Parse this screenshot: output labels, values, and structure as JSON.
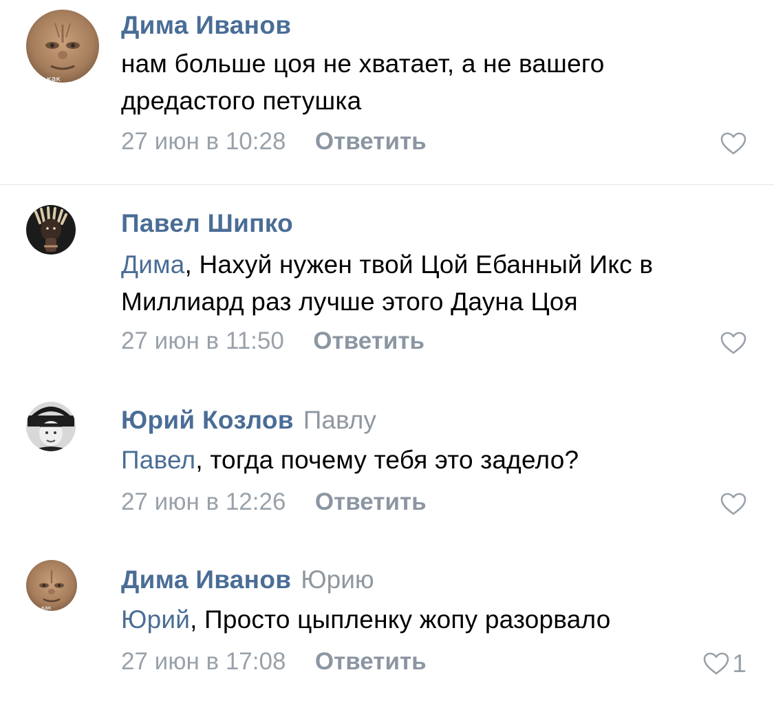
{
  "colors": {
    "author": "#4a6d96",
    "mention": "#4a6d96",
    "meta": "#99a1a9",
    "reply_button": "#8c96a2",
    "divider": "#e3e4e6"
  },
  "comments": [
    {
      "author": "Дима Иванов",
      "reply_to": "",
      "mention": "",
      "text_lines": [
        "нам больше цоя не хватает, а не вашего",
        "дредастого петушка"
      ],
      "date": "27 июн в 10:28",
      "reply_label": "Ответить",
      "likes": "",
      "avatar_icon": "face-photo-avatar",
      "avatar_caption": "как"
    },
    {
      "author": "Павел Шипко",
      "reply_to": "",
      "mention": "Дима",
      "text_lines": [
        ", Нахуй нужен твой Цой Ебанный Икс в",
        "Миллиард раз лучше этого Дауна Цоя"
      ],
      "date": "27 июн в 11:50",
      "reply_label": "Ответить",
      "likes": "",
      "avatar_icon": "dreadlocks-photo-avatar"
    },
    {
      "author": "Юрий Козлов",
      "reply_to": "Павлу",
      "mention": "Павел",
      "text_lines": [
        ", тогда почему тебя это задело?"
      ],
      "date": "27 июн в 12:26",
      "reply_label": "Ответить",
      "likes": "",
      "avatar_icon": "black-and-white-photo-avatar"
    },
    {
      "author": "Дима Иванов",
      "reply_to": "Юрию",
      "mention": "Юрий",
      "text_lines": [
        ", Просто цыпленку жопу разорвало"
      ],
      "date": "27 июн в 17:08",
      "reply_label": "Ответить",
      "likes": "1",
      "avatar_icon": "face-photo-avatar",
      "avatar_caption": "как"
    }
  ]
}
